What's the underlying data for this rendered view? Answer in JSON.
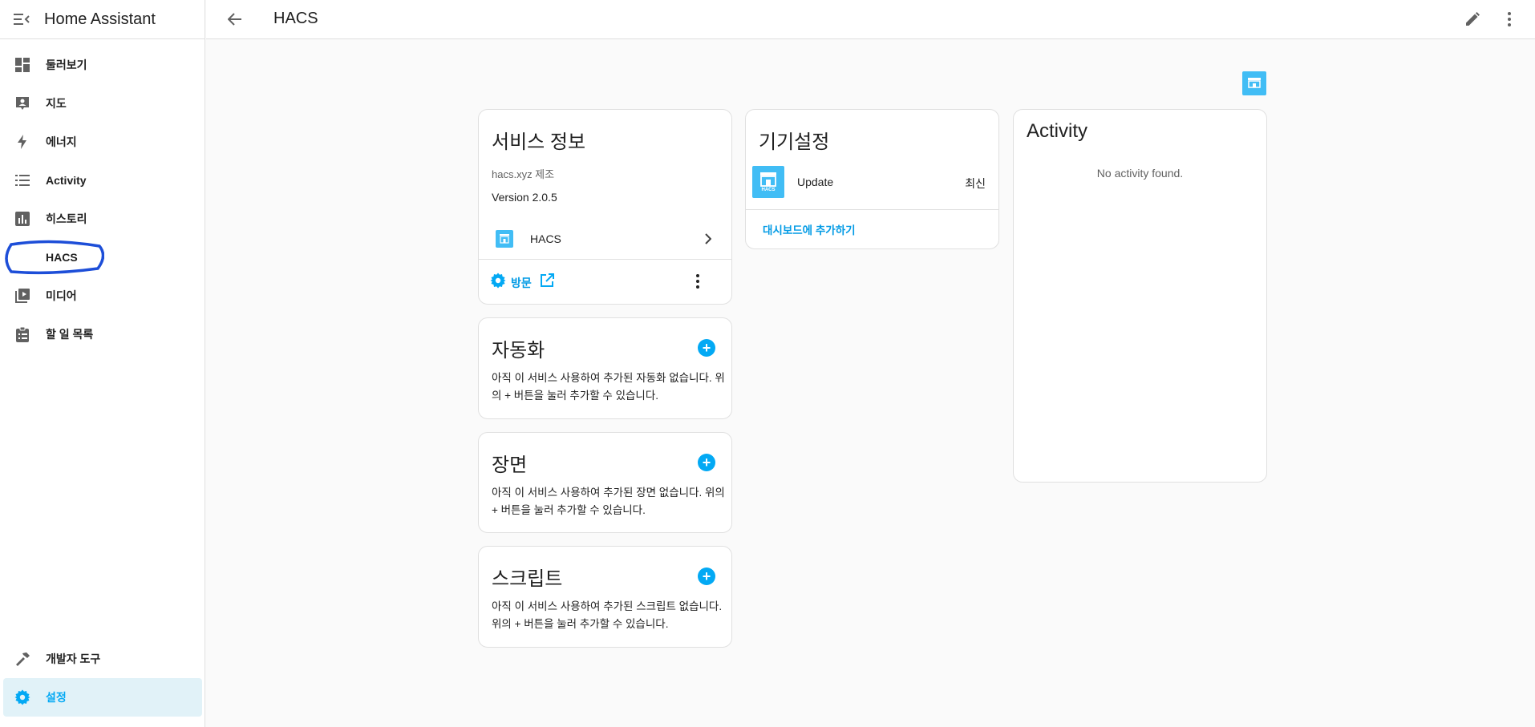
{
  "app": {
    "title": "Home Assistant"
  },
  "sidebar": {
    "items": [
      {
        "label": "둘러보기",
        "icon": "dashboard-icon"
      },
      {
        "label": "지도",
        "icon": "map-account-icon"
      },
      {
        "label": "에너지",
        "icon": "lightning-icon"
      },
      {
        "label": "Activity",
        "icon": "format-list-icon"
      },
      {
        "label": "히스토리",
        "icon": "chart-box-icon"
      },
      {
        "label": "HACS",
        "icon": "hacs-icon"
      },
      {
        "label": "미디어",
        "icon": "play-box-multiple-icon"
      },
      {
        "label": "할 일 목록",
        "icon": "clipboard-list-icon"
      }
    ],
    "bottom_items": [
      {
        "label": "개발자 도구",
        "icon": "hammer-icon"
      },
      {
        "label": "설정",
        "icon": "cog-icon",
        "active": true
      }
    ]
  },
  "header": {
    "title": "HACS"
  },
  "service_info": {
    "title": "서비스 정보",
    "manufacturer": "hacs.xyz 제조",
    "version": "Version 2.0.5",
    "device_label": "HACS",
    "visit_label": "방문"
  },
  "automation": {
    "title": "자동화",
    "empty_text": "아직 이 서비스 사용하여 추가된 자동화 없습니다. 위의 + 버튼을 눌러 추가할 수 있습니다."
  },
  "scenes": {
    "title": "장면",
    "empty_text": "아직 이 서비스 사용하여 추가된 장면 없습니다. 위의 + 버튼을 눌러 추가할 수 있습니다."
  },
  "scripts": {
    "title": "스크립트",
    "empty_text": "아직 이 서비스 사용하여 추가된 스크립트 없습니다. 위의 + 버튼을 눌러 추가할 수 있습니다."
  },
  "device_settings": {
    "title": "기기설정",
    "entity_name": "Update",
    "entity_state": "최신",
    "entity_logo_text": "HACS",
    "add_to_dashboard": "대시보드에 추가하기"
  },
  "activity": {
    "title": "Activity",
    "empty_text": "No activity found."
  },
  "colors": {
    "accent": "#03a9f4",
    "hacs_blue": "#41bdf5",
    "annotation": "#1d4ed8"
  }
}
